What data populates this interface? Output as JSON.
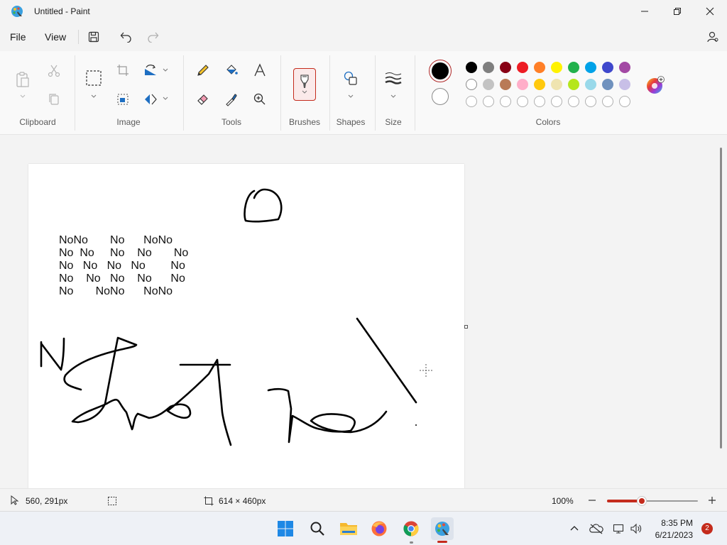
{
  "window": {
    "title": "Untitled - Paint"
  },
  "menu": {
    "file": "File",
    "view": "View"
  },
  "ribbon": {
    "groups": {
      "clipboard": "Clipboard",
      "image": "Image",
      "tools": "Tools",
      "brushes": "Brushes",
      "shapes": "Shapes",
      "size": "Size",
      "colors": "Colors"
    },
    "palette_row1": [
      "#000000",
      "#7f7f7f",
      "#880015",
      "#ed1c24",
      "#ff7f27",
      "#fff200",
      "#22b14c",
      "#00a2e8",
      "#3f48cc",
      "#a349a4"
    ],
    "palette_row2": [
      "#ffffff",
      "#c3c3c3",
      "#b97a57",
      "#ffaec9",
      "#ffc90e",
      "#efe4b0",
      "#b5e61d",
      "#99d9ea",
      "#7092be",
      "#c8bfe7"
    ],
    "palette_row3": [
      "#ffffff",
      "#ffffff",
      "#ffffff",
      "#ffffff",
      "#ffffff",
      "#ffffff",
      "#ffffff",
      "#ffffff",
      "#ffffff",
      "#ffffff"
    ],
    "color1": "#000000",
    "color2": "#ffffff"
  },
  "canvas": {
    "text_lines": [
      "NoNo       No      NoNo",
      "No  No     No    No       No",
      "No   No   No   No        No",
      "No    No   No    No      No",
      "No       NoNo      NoNo"
    ]
  },
  "status": {
    "cursor_pos": "560, 291px",
    "canvas_size": "614 × 460px",
    "zoom": "100%",
    "zoom_level": 0.38
  },
  "taskbar": {
    "time": "8:35 PM",
    "date": "6/21/2023",
    "notifications": "2"
  }
}
